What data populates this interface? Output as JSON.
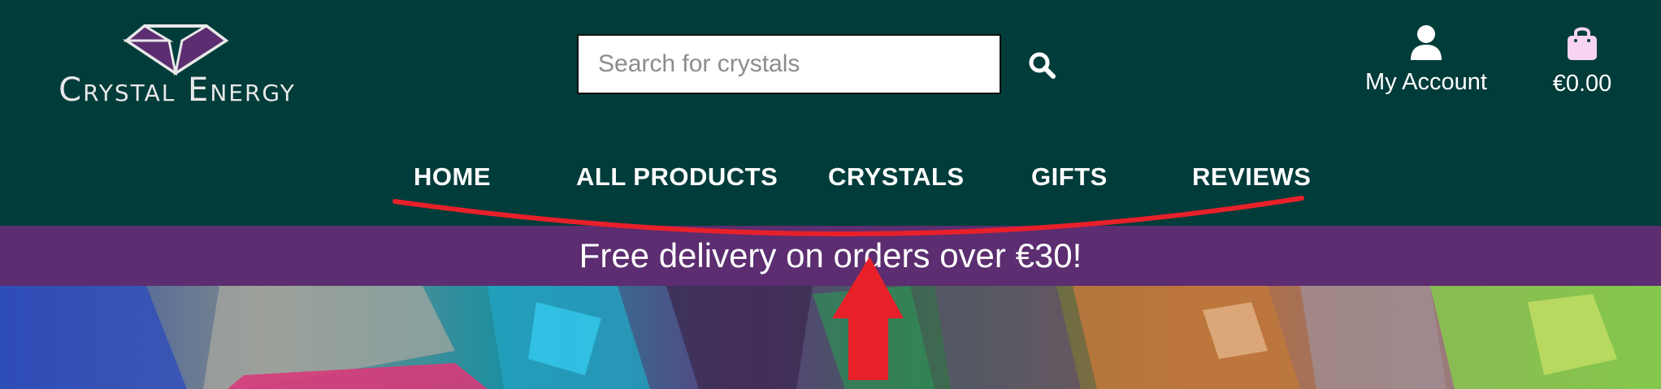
{
  "header": {
    "logo": {
      "brand_name": "Crystal Energy"
    },
    "search": {
      "placeholder": "Search for crystals",
      "value": ""
    },
    "account_label": "My Account",
    "cart_total": "€0.00"
  },
  "nav": {
    "items": [
      {
        "label": "HOME"
      },
      {
        "label": "ALL PRODUCTS"
      },
      {
        "label": "CRYSTALS"
      },
      {
        "label": "GIFTS"
      },
      {
        "label": "REVIEWS"
      }
    ]
  },
  "promo": {
    "text": "Free delivery on orders over €30!"
  },
  "colors": {
    "header_bg": "#003c3a",
    "promo_bg": "#5c2d70",
    "accent_purple": "#5c2d70",
    "icon_pink": "#f7d4ef",
    "annotation_red": "#e8202a"
  },
  "icons": [
    "search-icon",
    "user-icon",
    "shopping-bag-icon",
    "gem-icon"
  ]
}
